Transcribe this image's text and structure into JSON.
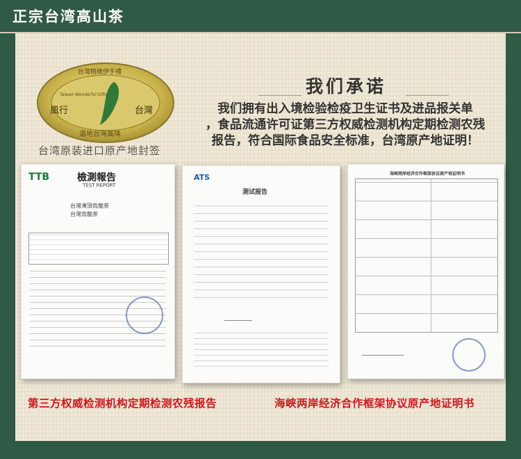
{
  "header": {
    "title": "正宗台湾高山茶"
  },
  "seal": {
    "top_text": "台灣精緻伊手禮",
    "english": "Taiwan Wonderful Gifts",
    "left_text": "風行",
    "right_text": "台灣",
    "bottom_text": "道地台灣風味",
    "caption": "台湾原装进口原产地封签"
  },
  "promise": {
    "title": "我们承诺",
    "lines": [
      "我们拥有出入境检验检疫卫生证书及进品报关单",
      "，食品流通许可证第三方权威检测机构定期检测农残",
      "报告，符合国际食品安全标准，台湾原产地证明！"
    ]
  },
  "doc1": {
    "logo": "TTB",
    "title": "檢測報告",
    "subtitle": "TEST REPORT",
    "field1": "台灣凍頂烏龍茶",
    "field2": "台灣烏龍茶"
  },
  "doc2": {
    "logo": "ATS",
    "title": "测试报告"
  },
  "doc3": {
    "heading": "海峡两岸经济合作框架协议原产地证明书"
  },
  "captions": {
    "left": "第三方权威检测机构定期检测农残报告",
    "right": "海峡两岸经济合作框架协议原产地证明书"
  },
  "colors": {
    "brand_green": "#2f5a45",
    "caption_red": "#d0161b",
    "seal_gold": "#c8b24a"
  }
}
